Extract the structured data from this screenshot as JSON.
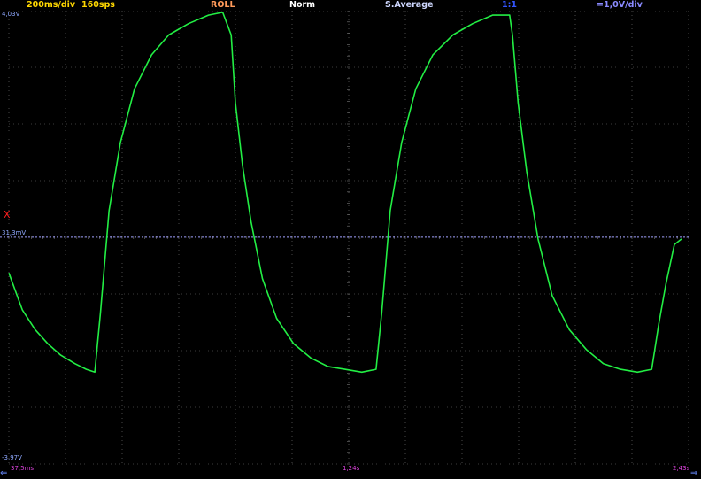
{
  "status": {
    "timebase": "200ms/div",
    "sample_rate": "160sps",
    "mode": "ROLL",
    "trigger": "Norm",
    "acquisition": "S.Average",
    "probe": "1:1",
    "vdiv": "=1,0V/div"
  },
  "scale": {
    "top": "4,03V",
    "bottom": "-3,97V",
    "ref_level": "31,3mV",
    "trigger_marker": "X"
  },
  "footer": {
    "start": "37,5ms",
    "mid": "1,24s",
    "end": "2,43s",
    "arrow_left": "⇐",
    "arrow_right": "⇒"
  },
  "colors": {
    "timebase": "#ffd700",
    "mode": "#ff9a5a",
    "trigger": "#ffffff",
    "acquisition": "#cfd8ff",
    "probe": "#3355ff",
    "vdiv": "#8a8aff",
    "trace": "#22ee44",
    "ref_line": "#a0a0ff",
    "grid": "#7a7a7a",
    "marker": "#ff2020",
    "scale_label": "#8fa8ff",
    "footer_label": "#e044e0"
  },
  "chart_data": {
    "type": "line",
    "title": "",
    "xlabel": "",
    "ylabel": "",
    "x_unit": "s",
    "y_unit": "V",
    "xlim": [
      0.0375,
      2.43
    ],
    "ylim": [
      -3.97,
      4.03
    ],
    "grid": true,
    "reference_level_v": 0.0313,
    "series": [
      {
        "name": "",
        "x": [
          0.0375,
          0.085,
          0.13,
          0.175,
          0.22,
          0.27,
          0.31,
          0.34,
          0.36,
          0.39,
          0.43,
          0.48,
          0.54,
          0.6,
          0.67,
          0.74,
          0.79,
          0.82,
          0.835,
          0.86,
          0.89,
          0.93,
          0.98,
          1.04,
          1.1,
          1.16,
          1.22,
          1.28,
          1.33,
          1.35,
          1.38,
          1.42,
          1.47,
          1.53,
          1.6,
          1.67,
          1.74,
          1.8,
          1.81,
          1.83,
          1.86,
          1.9,
          1.95,
          2.01,
          2.07,
          2.13,
          2.19,
          2.25,
          2.3,
          2.325,
          2.35,
          2.38,
          2.405
        ],
        "y": [
          -0.6,
          -1.25,
          -1.6,
          -1.85,
          -2.05,
          -2.2,
          -2.3,
          -2.35,
          -1.3,
          0.5,
          1.7,
          2.65,
          3.25,
          3.6,
          3.8,
          3.95,
          4.0,
          3.6,
          2.4,
          1.3,
          0.3,
          -0.7,
          -1.4,
          -1.85,
          -2.1,
          -2.25,
          -2.3,
          -2.35,
          -2.3,
          -1.3,
          0.5,
          1.7,
          2.65,
          3.25,
          3.6,
          3.8,
          3.95,
          3.95,
          3.6,
          2.4,
          1.2,
          0.0,
          -1.0,
          -1.6,
          -1.95,
          -2.2,
          -2.3,
          -2.35,
          -2.3,
          -1.5,
          -0.8,
          -0.1,
          0.0
        ]
      }
    ]
  }
}
